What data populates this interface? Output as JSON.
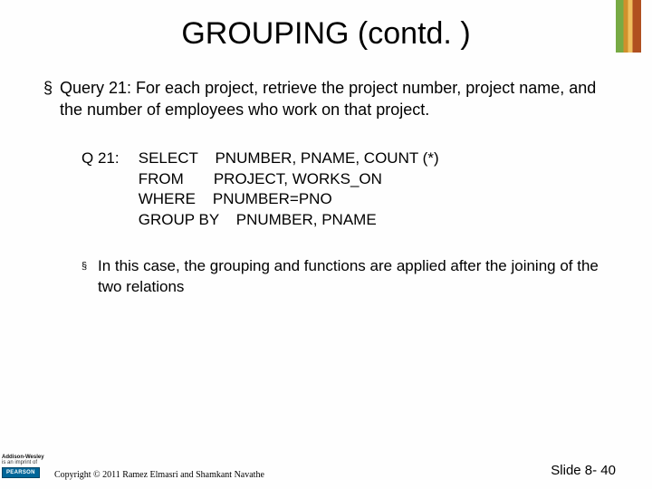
{
  "title": "GROUPING (contd. )",
  "bullet1": "Query 21: For each project, retrieve the project number, project name, and the number of employees who work on that project.",
  "query": {
    "label": "Q 21:",
    "sql": "SELECT    PNUMBER, PNAME, COUNT (*)\nFROM       PROJECT, WORKS_ON\nWHERE    PNUMBER=PNO\nGROUP BY    PNUMBER, PNAME"
  },
  "sub_bullet": "In this case, the grouping and functions are applied after the joining of the two relations",
  "footer": {
    "aw": "Addison-Wesley",
    "imprint": "is an imprint of",
    "pearson": "PEARSON",
    "copyright": "Copyright © 2011 Ramez Elmasri and Shamkant Navathe",
    "slidenum": "Slide 8- 40"
  }
}
